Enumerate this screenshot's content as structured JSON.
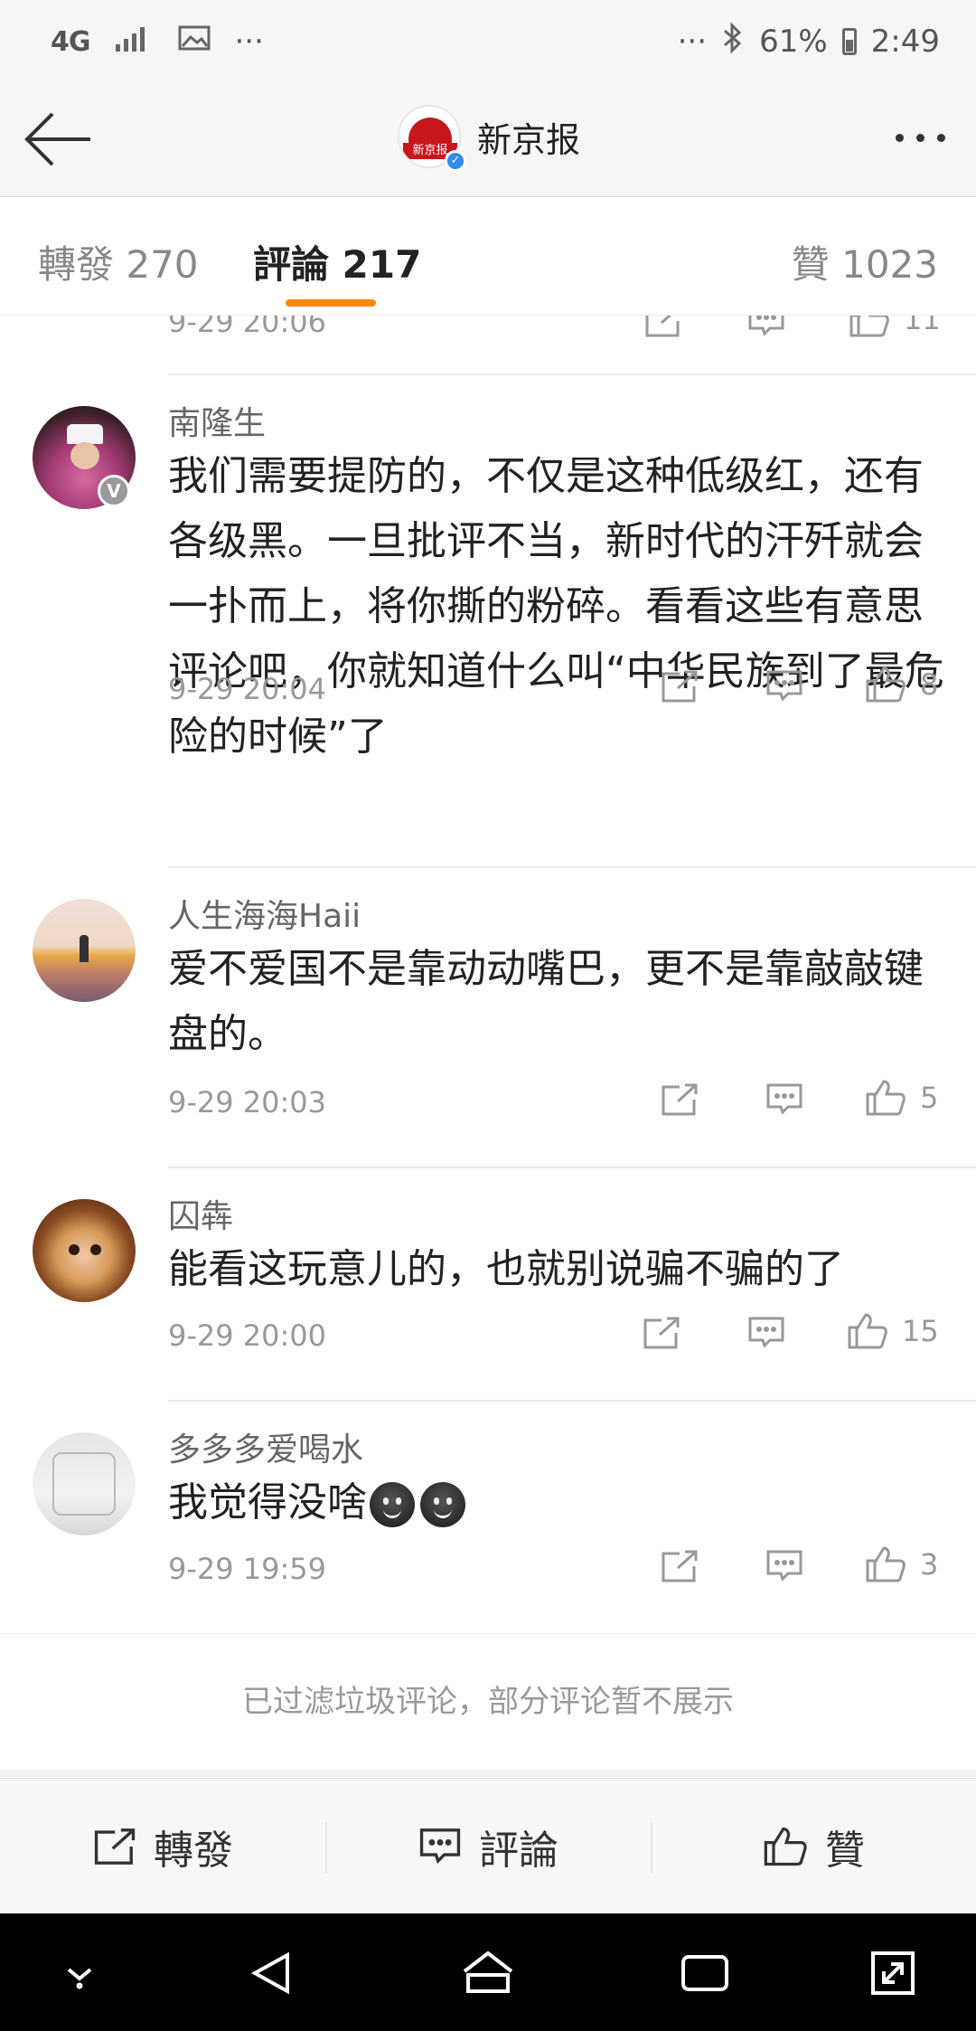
{
  "status_bar": {
    "network": "4G",
    "more_left": "···",
    "more_right": "···",
    "battery": "61%",
    "time": "2:49"
  },
  "header": {
    "title": "新京报",
    "logo_text": "新京报"
  },
  "tabs": [
    {
      "label": "轉發 270"
    },
    {
      "label": "評論 217"
    },
    {
      "label": "贊 1023"
    }
  ],
  "partial_comment": {
    "time": "9-29 20:06",
    "likes": "11"
  },
  "comments": [
    {
      "username": "南隆生",
      "verified": true,
      "text": "我们需要提防的，不仅是这种低级红，还有各级黑。一旦批评不当，新时代的汗歼就会一扑而上，将你撕的粉碎。看看这些有意思评论吧，你就知道什么叫“中华民族到了最危险的时候”了",
      "time": "9-29 20:04",
      "likes": "8"
    },
    {
      "username": "人生海海Haii",
      "text": "爱不爱国不是靠动动嘴巴，更不是靠敲敲键盘的。",
      "time": "9-29 20:03",
      "likes": "5"
    },
    {
      "username": "囚犇",
      "text": "能看这玩意儿的，也就别说骗不骗的了",
      "time": "9-29 20:00",
      "likes": "15"
    },
    {
      "username": "多多多爱喝水",
      "text": "我觉得没啥",
      "time": "9-29 19:59",
      "likes": "3"
    }
  ],
  "notice": "已过滤垃圾评论，部分评论暂不展示",
  "bottom_bar": {
    "repost": "轉發",
    "comment": "評論",
    "like": "贊"
  },
  "icons": [
    "back-arrow-icon",
    "more-icon",
    "share-icon",
    "comment-icon",
    "like-icon",
    "nav-down-icon",
    "nav-back-icon",
    "nav-home-icon",
    "nav-recents-icon",
    "nav-expand-icon"
  ],
  "colors": {
    "accent": "#ff8a00",
    "brand_red": "#c8161d",
    "verified_blue": "#2d8ef0"
  }
}
